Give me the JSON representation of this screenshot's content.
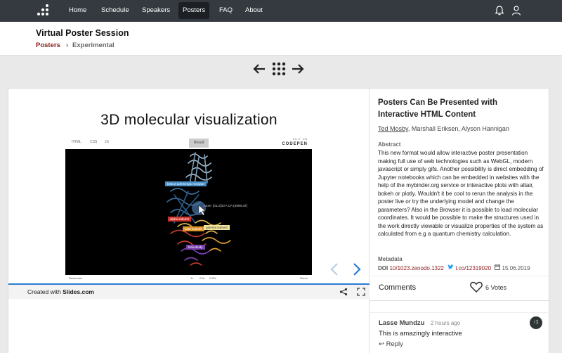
{
  "nav": {
    "items": [
      "Home",
      "Schedule",
      "Speakers",
      "Posters",
      "FAQ",
      "About"
    ],
    "active": "Posters"
  },
  "header": {
    "title": "Virtual Poster Session",
    "breadcrumb": [
      "Posters",
      "Experimental"
    ]
  },
  "slide": {
    "title": "3D molecular visualization",
    "codepen": {
      "tabs": [
        "HTML",
        "CSS",
        "JS"
      ],
      "result": "Result",
      "edit_on": "EDIT ON",
      "brand": "CODEPEN",
      "resources": "Resources",
      "zoom": [
        "1x",
        "0.5x",
        "0.25x"
      ],
      "rerun": "Rerun",
      "labels": [
        "beta 2 adrenergic receptor",
        "Atom: [GLU]10 A CA (3SN6.cif)",
        "alpha subunit",
        "beta subunit",
        "gamma subunit",
        "Nanobody"
      ]
    },
    "footer_prefix": "Created with",
    "footer_brand": "Slides.com"
  },
  "poster": {
    "title": "Posters Can Be Presented with Interactive HTML Content",
    "authors_first": "Ted Mosby",
    "authors_rest": ", Marshall Eriksen, Alyson Hannigan",
    "abstract_label": "Abstract",
    "abstract": "This new format would allow interactive poster presentation making full use of web technologies such as WebGL, modern javascript or simply gifs. Another possibility is direct embedding of Jupyter notebooks which can be embedded in websites with the help of the mybinder.org service or interactive plots with altair, bokeh or plotly. Wouldn't it be cool to rerun the analysis in the poster live or try the underlying model and change the parameters? Also in the Browser it is possible to load molecular coordinates. It would be possible to make the structures used in the work directly viewable or visualize properties of the system as calculated from e.g a quantum chemistry calculation.",
    "metadata_label": "Metadata",
    "doi_label": "DOI",
    "doi": "10/1023.zenodo.1322",
    "twitter": "t.co/12319020",
    "date": "15.06.2019"
  },
  "comments": {
    "label": "Comments",
    "votes": "6 Votes",
    "items": [
      {
        "author": "Lasse Mundzu",
        "time": "2 hours ago",
        "text": "This is amazingly interactive",
        "reply": "Reply",
        "votes": "1"
      }
    ]
  },
  "colors": {
    "nav_bg": "#343a40",
    "accent": "#8b1a1a",
    "link_blue": "#2b7bd4"
  }
}
